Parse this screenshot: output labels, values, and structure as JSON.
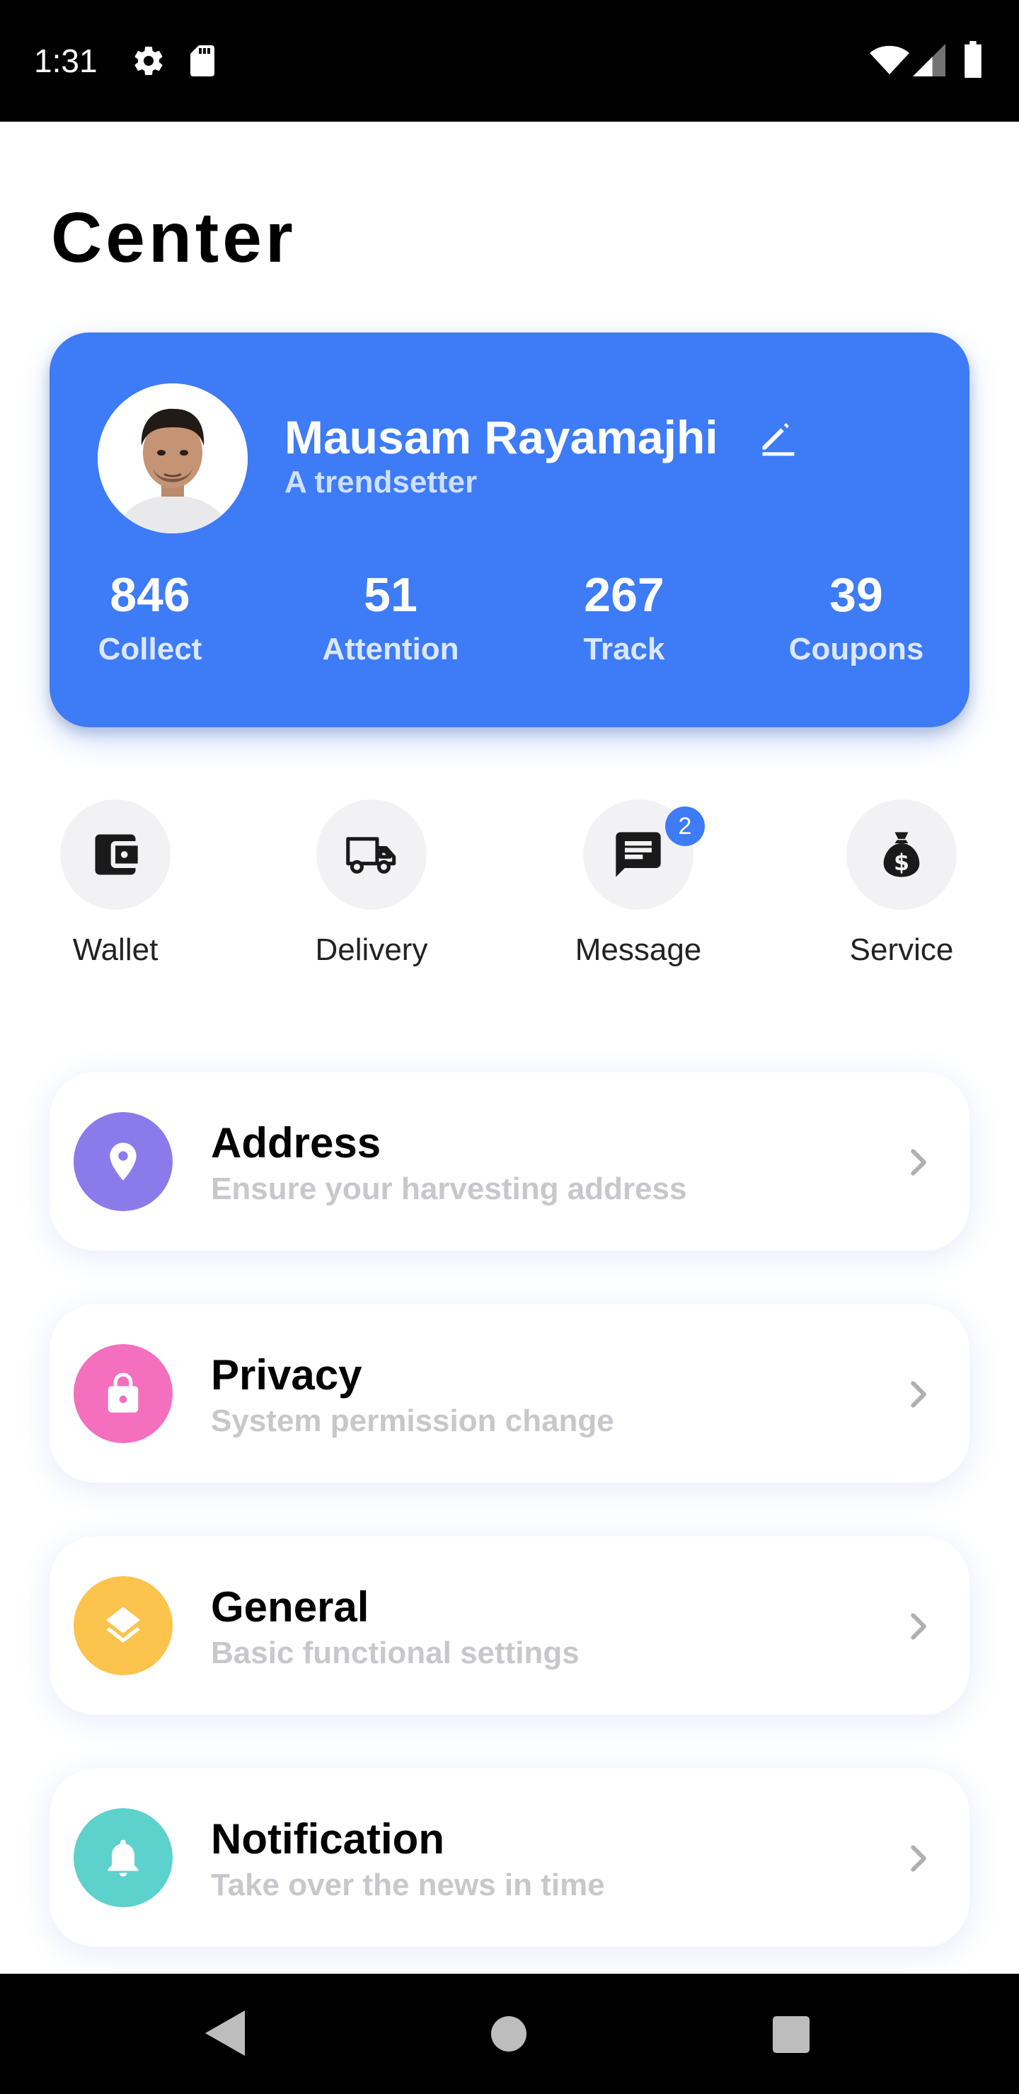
{
  "status_bar": {
    "time": "1:31",
    "icons": [
      "gear-icon",
      "sd-card-icon",
      "wifi-icon",
      "signal-icon",
      "battery-icon"
    ]
  },
  "page": {
    "title": "Center"
  },
  "profile": {
    "name": "Mausam Rayamajhi",
    "subtitle": "A trendsetter",
    "stats": [
      {
        "value": "846",
        "label": "Collect"
      },
      {
        "value": "51",
        "label": "Attention"
      },
      {
        "value": "267",
        "label": "Track"
      },
      {
        "value": "39",
        "label": "Coupons"
      }
    ]
  },
  "quick_actions": [
    {
      "label": "Wallet",
      "icon": "wallet-icon"
    },
    {
      "label": "Delivery",
      "icon": "truck-icon"
    },
    {
      "label": "Message",
      "icon": "message-icon",
      "badge": "2"
    },
    {
      "label": "Service",
      "icon": "money-bag-icon"
    }
  ],
  "menu": [
    {
      "title": "Address",
      "subtitle": "Ensure your harvesting address",
      "icon": "location-pin-icon",
      "color": "#8b7bea"
    },
    {
      "title": "Privacy",
      "subtitle": "System permission change",
      "icon": "lock-icon",
      "color": "#f46fbe"
    },
    {
      "title": "General",
      "subtitle": "Basic functional settings",
      "icon": "layers-icon",
      "color": "#fcc34d"
    },
    {
      "title": "Notification",
      "subtitle": "Take over the news in time",
      "icon": "bell-icon",
      "color": "#5dd1cc"
    }
  ],
  "colors": {
    "primary": "#3d7bf7",
    "badge": "#3d7bf7"
  }
}
